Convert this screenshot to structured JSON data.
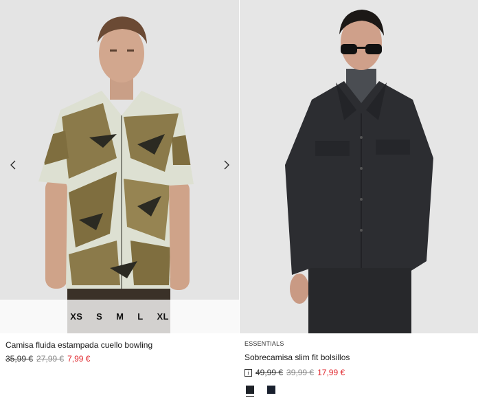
{
  "products": [
    {
      "name": "Camisa fluida estampada cuello bowling",
      "sizes": [
        "XS",
        "S",
        "M",
        "L",
        "XL"
      ],
      "price_original": "35,99 €",
      "price_previous": "27,99 €",
      "price_sale": "7,99 €"
    },
    {
      "tag": "ESSENTIALS",
      "name": "Sobrecamisa slim fit bolsillos",
      "info_icon": "i",
      "price_original": "49,99 €",
      "price_previous": "39,99 €",
      "price_sale": "17,99 €",
      "colors": [
        "#1e2228",
        "#19202e"
      ]
    }
  ],
  "icons": {
    "prev": "chevron-left-icon",
    "next": "chevron-right-icon",
    "info": "info-icon"
  },
  "colors": {
    "sale": "#e0262c"
  }
}
